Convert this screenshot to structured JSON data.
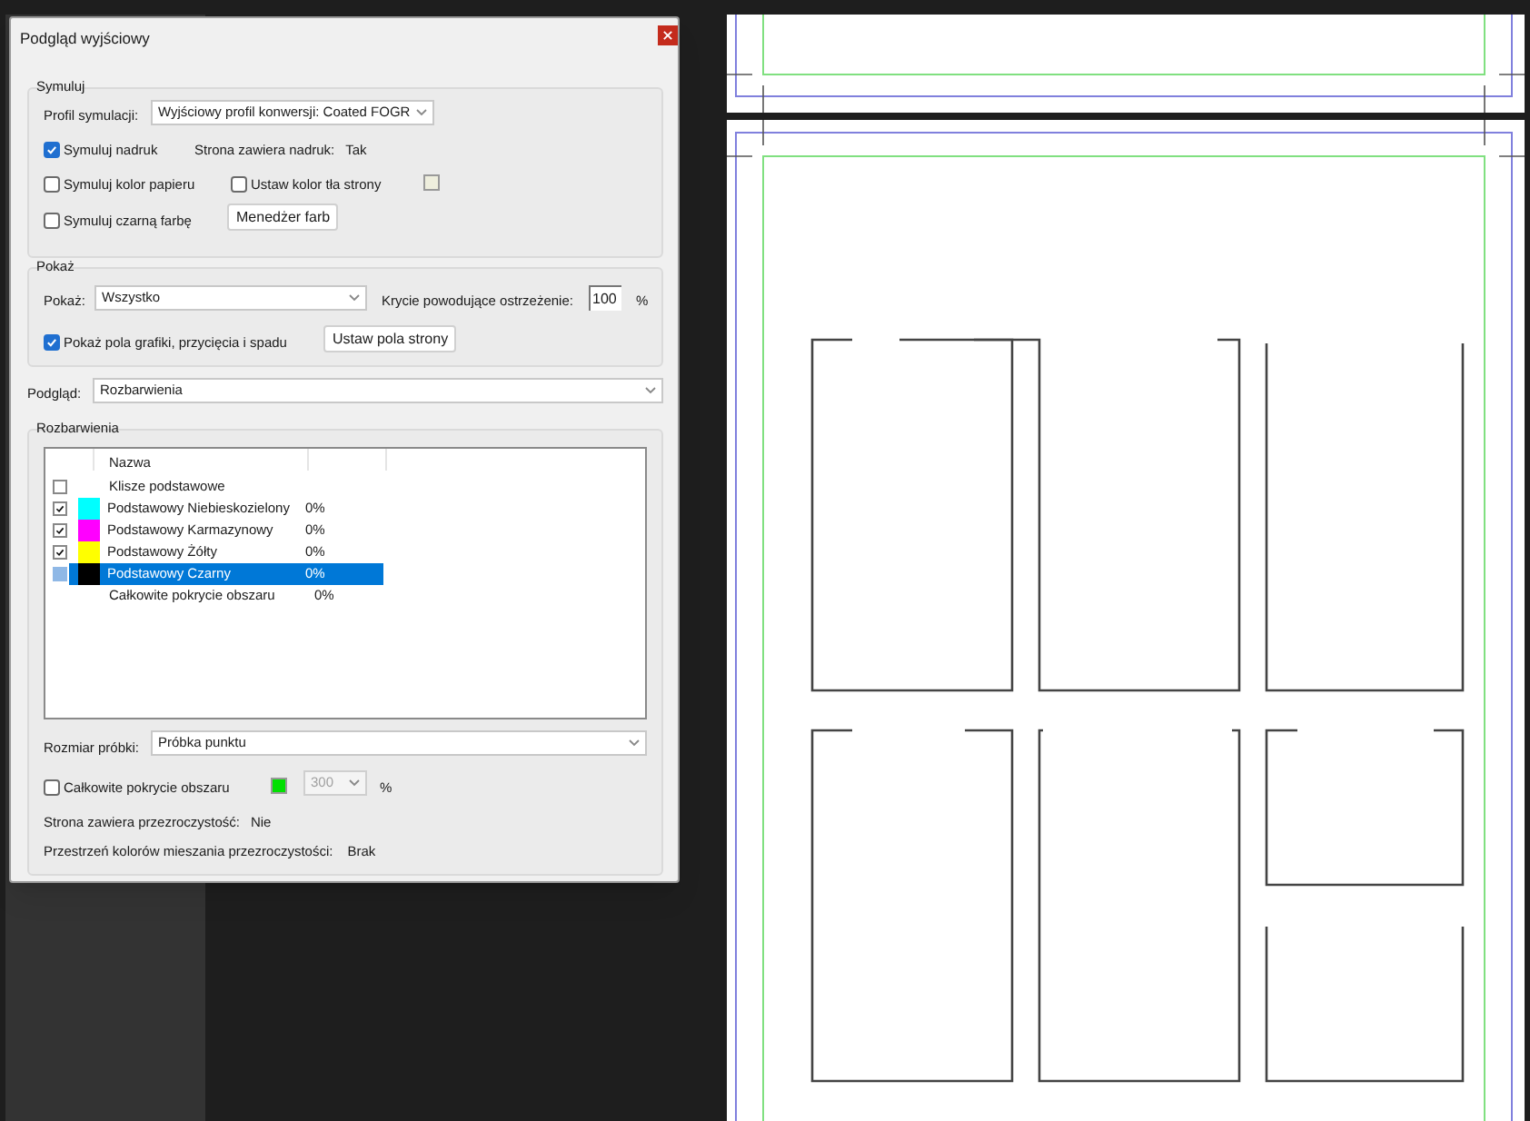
{
  "window": {
    "title": "Podgląd wyjściowy"
  },
  "simulate": {
    "title": "Symuluj",
    "profile": {
      "label": "Profil symulacji:",
      "value": "Wyjściowy profil konwersji: Coated FOGR"
    },
    "overprint": {
      "label": "Symuluj nadruk",
      "checked": true
    },
    "overprint_info": {
      "label": "Strona zawiera nadruk:",
      "value": "Tak"
    },
    "paper_color": {
      "label": "Symuluj kolor papieru",
      "checked": false
    },
    "page_background": {
      "label": "Ustaw kolor tła strony",
      "checked": false
    },
    "black_ink": {
      "label": "Symuluj czarną farbę",
      "checked": false
    },
    "ink_manager_button": "Menedżer farb"
  },
  "show": {
    "title": "Pokaż",
    "filter": {
      "label": "Pokaż:",
      "value": "Wszystko"
    },
    "warning": {
      "label": "Krycie powodujące ostrzeżenie:",
      "value": "100",
      "unit": "%"
    },
    "boxes": {
      "label": "Pokaż pola grafiki, przycięcia i spadu",
      "checked": true
    },
    "page_boxes_button": "Ustaw pola strony"
  },
  "preview": {
    "label": "Podgląd:",
    "value": "Rozbarwienia"
  },
  "separations": {
    "title": "Rozbarwienia",
    "column_name": "Nazwa",
    "rows": [
      {
        "kind": "master",
        "name": "Klisze podstawowe",
        "checked": false,
        "selected": false
      },
      {
        "kind": "plate",
        "name": "Podstawowy Niebieskozielony",
        "value": "0%",
        "color": "#00ffff",
        "checked": true,
        "selected": false
      },
      {
        "kind": "plate",
        "name": "Podstawowy Karmazynowy",
        "value": "0%",
        "color": "#ff00ff",
        "checked": true,
        "selected": false
      },
      {
        "kind": "plate",
        "name": "Podstawowy Żółty",
        "value": "0%",
        "color": "#ffff00",
        "checked": true,
        "selected": false
      },
      {
        "kind": "plate",
        "name": "Podstawowy Czarny",
        "value": "0%",
        "color": "#000000",
        "checked": false,
        "selected": true
      },
      {
        "kind": "total",
        "name": "Całkowite pokrycie obszaru",
        "value": "0%",
        "selected": false
      }
    ],
    "sample_size": {
      "label": "Rozmiar próbki:",
      "value": "Próbka punktu"
    },
    "total_coverage": {
      "label": "Całkowite pokrycie obszaru",
      "checked": false,
      "value": "300",
      "unit": "%",
      "disabled": true
    },
    "transparency": {
      "label": "Strona zawiera przezroczystość:",
      "value": "Nie"
    },
    "blend_space": {
      "label": "Przestrzeń kolorów mieszania przezroczystości:",
      "value": "Brak"
    }
  }
}
